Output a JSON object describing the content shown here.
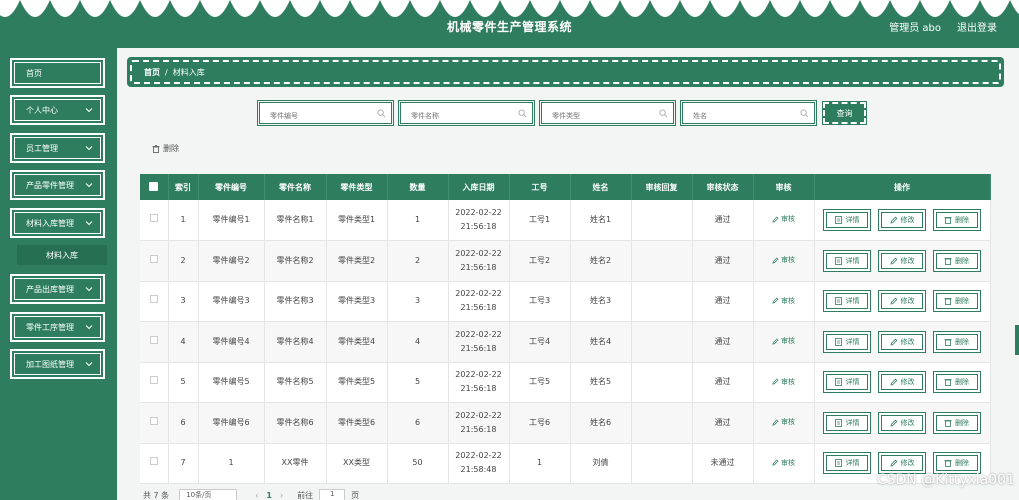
{
  "header": {
    "title": "机械零件生产管理系统",
    "user": "管理员 abo",
    "logout": "退出登录"
  },
  "sidebar": {
    "items": [
      {
        "label": "首页",
        "has_chevron": false
      },
      {
        "label": "个人中心",
        "has_chevron": true
      },
      {
        "label": "员工管理",
        "has_chevron": true
      },
      {
        "label": "产品零件管理",
        "has_chevron": true
      },
      {
        "label": "材料入库管理",
        "has_chevron": true
      },
      {
        "label": "产品出库管理",
        "has_chevron": true
      },
      {
        "label": "零件工序管理",
        "has_chevron": true
      },
      {
        "label": "加工图纸管理",
        "has_chevron": true
      }
    ],
    "submenu_active": "材料入库"
  },
  "breadcrumb": {
    "home": "首页",
    "separator": "/",
    "current": "材料入库"
  },
  "search": {
    "fields": [
      {
        "placeholder": "零件编号"
      },
      {
        "placeholder": "零件名称"
      },
      {
        "placeholder": "零件类型"
      },
      {
        "placeholder": "姓名"
      }
    ],
    "query_button": "查询"
  },
  "actions": {
    "delete_label": "删除"
  },
  "table": {
    "columns": [
      "索引",
      "零件编号",
      "零件名称",
      "零件类型",
      "数量",
      "入库日期",
      "工号",
      "姓名",
      "审核回复",
      "审核状态",
      "审核",
      "操作"
    ],
    "rows": [
      {
        "index": "1",
        "part_no": "零件编号1",
        "part_name": "零件名称1",
        "part_type": "零件类型1",
        "qty": "1",
        "date": "2022-02-22",
        "time": "21:56:18",
        "emp_no": "工号1",
        "name": "姓名1",
        "reply": "",
        "status": "通过"
      },
      {
        "index": "2",
        "part_no": "零件编号2",
        "part_name": "零件名称2",
        "part_type": "零件类型2",
        "qty": "2",
        "date": "2022-02-22",
        "time": "21:56:18",
        "emp_no": "工号2",
        "name": "姓名2",
        "reply": "",
        "status": "通过"
      },
      {
        "index": "3",
        "part_no": "零件编号3",
        "part_name": "零件名称3",
        "part_type": "零件类型3",
        "qty": "3",
        "date": "2022-02-22",
        "time": "21:56:18",
        "emp_no": "工号3",
        "name": "姓名3",
        "reply": "",
        "status": "通过"
      },
      {
        "index": "4",
        "part_no": "零件编号4",
        "part_name": "零件名称4",
        "part_type": "零件类型4",
        "qty": "4",
        "date": "2022-02-22",
        "time": "21:56:18",
        "emp_no": "工号4",
        "name": "姓名4",
        "reply": "",
        "status": "通过"
      },
      {
        "index": "5",
        "part_no": "零件编号5",
        "part_name": "零件名称5",
        "part_type": "零件类型5",
        "qty": "5",
        "date": "2022-02-22",
        "time": "21:56:18",
        "emp_no": "工号5",
        "name": "姓名5",
        "reply": "",
        "status": "通过"
      },
      {
        "index": "6",
        "part_no": "零件编号6",
        "part_name": "零件名称6",
        "part_type": "零件类型6",
        "qty": "6",
        "date": "2022-02-22",
        "time": "21:56:18",
        "emp_no": "工号6",
        "name": "姓名6",
        "reply": "",
        "status": "通过"
      },
      {
        "index": "7",
        "part_no": "1",
        "part_name": "XX零件",
        "part_type": "XX类型",
        "qty": "50",
        "date": "2022-02-22",
        "time": "21:58:48",
        "emp_no": "1",
        "name": "刘倩",
        "reply": "",
        "status": "未通过"
      }
    ],
    "audit_label": "审核",
    "detail_label": "详情",
    "edit_label": "修改",
    "delete_label": "删除"
  },
  "pagination": {
    "total": "共 7 条",
    "page_size": "10条/页",
    "current_page": "1",
    "goto_label": "前往",
    "goto_value": "1",
    "page_suffix": "页"
  },
  "watermark": "CSDN @Kittyxia001",
  "colors": {
    "primary": "#2d7d5e",
    "background": "#f3f5f4"
  }
}
